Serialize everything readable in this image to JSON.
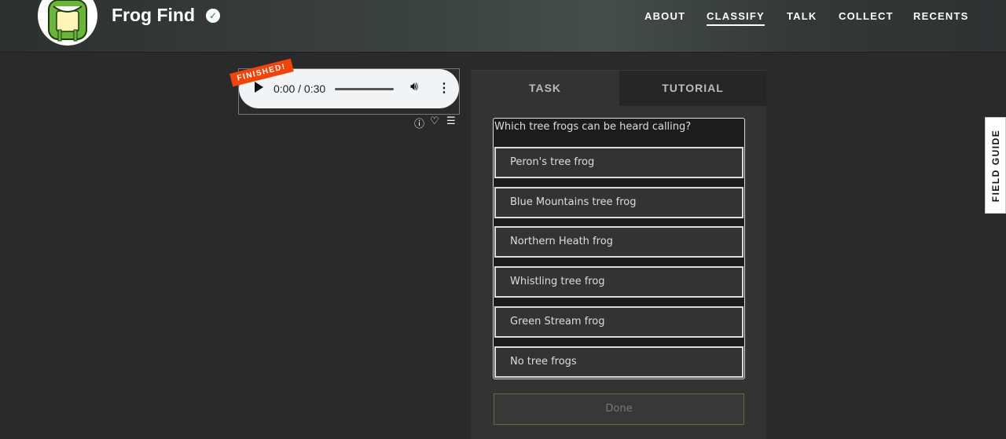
{
  "header": {
    "title": "Frog Find",
    "nav": [
      "ABOUT",
      "CLASSIFY",
      "TALK",
      "COLLECT",
      "RECENTS"
    ],
    "active_nav": "CLASSIFY"
  },
  "subject": {
    "status_badge": "FINISHED!",
    "audio_time": "0:00 / 0:30",
    "progress": 0
  },
  "panel": {
    "tabs": [
      "TASK",
      "TUTORIAL"
    ],
    "question": "Which tree frogs can be heard calling?",
    "answers": [
      "Peron's tree frog",
      "Blue Mountains tree frog",
      "Northern Heath frog",
      "Whistling tree frog",
      "Green Stream frog",
      "No tree frogs"
    ],
    "done_label": "Done"
  },
  "field_guide": "FIELD GUIDE",
  "colors": {
    "accent": "#f0440c",
    "done_border": "#5b7040"
  }
}
